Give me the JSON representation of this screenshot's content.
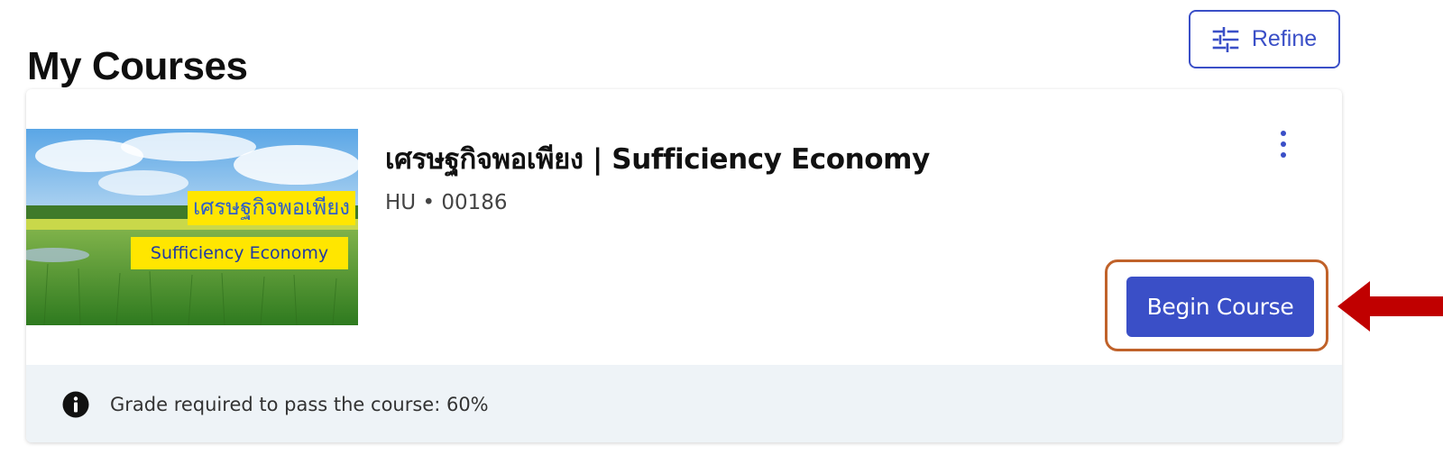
{
  "page": {
    "title": "My Courses"
  },
  "toolbar": {
    "refine_label": "Refine",
    "refine_icon": "sliders-icon"
  },
  "course": {
    "title": "เศรษฐกิจพอเพียง | Sufficiency Economy",
    "code": "HU • 00186",
    "thumbnail": {
      "label_th": "เศรษฐกิจพอเพียง",
      "label_en": "Sufficiency Economy"
    },
    "menu_icon": "kebab-menu-icon",
    "begin_label": "Begin Course",
    "footer": {
      "info_icon": "info-icon",
      "grade_text": "Grade required to pass the course: 60%"
    }
  },
  "colors": {
    "accent": "#3a4fc7",
    "highlight_border": "#c0622a",
    "annotation_arrow": "#c00000",
    "footer_bg": "#eef3f7",
    "thumb_label_bg": "#ffe600"
  }
}
